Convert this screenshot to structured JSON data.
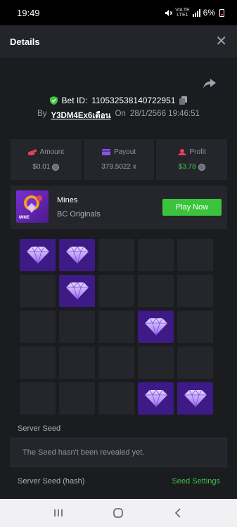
{
  "status_bar": {
    "time": "19:49",
    "lte1": "LTE1",
    "volte": "VoLTE",
    "battery": "6%"
  },
  "header": {
    "title": "Details",
    "close_icon": "close-icon"
  },
  "bet": {
    "label": "Bet ID:",
    "id": "110532538140722951",
    "by_label": "By",
    "user": "Y3DM4Ex6เดือน",
    "on_label": "On",
    "date": "28/1/2566 19:46:51"
  },
  "stats": {
    "amount": {
      "label": "Amount",
      "value": "$0.01"
    },
    "payout": {
      "label": "Payout",
      "value": "379.5022 x"
    },
    "profit": {
      "label": "Profit",
      "value": "$3.78"
    }
  },
  "game": {
    "name": "Mines",
    "provider": "BC Originals",
    "play_label": "Play Now",
    "thumb_text": "MINE"
  },
  "board": {
    "gems": [
      [
        true,
        true,
        false,
        false,
        false
      ],
      [
        false,
        true,
        false,
        false,
        false
      ],
      [
        false,
        false,
        false,
        true,
        false
      ],
      [
        false,
        false,
        false,
        false,
        false
      ],
      [
        false,
        false,
        false,
        true,
        true
      ]
    ]
  },
  "seed": {
    "server_seed_label": "Server Seed",
    "server_seed_value": "The Seed hasn't been revealed yet.",
    "hash_label": "Server Seed (hash)",
    "settings_label": "Seed Settings"
  },
  "colors": {
    "accent_green": "#3bc43b",
    "gem_bg": "#3e1a86",
    "cell_bg": "#24262b"
  }
}
